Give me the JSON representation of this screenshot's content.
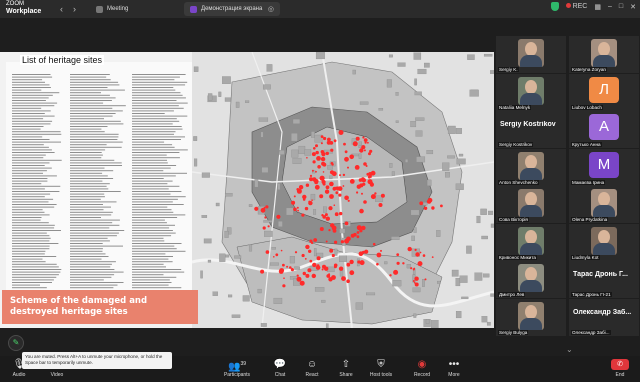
{
  "app": {
    "brand_top": "ZOOM",
    "brand_bottom": "Workplace"
  },
  "tabs": [
    {
      "label": "Meeting"
    },
    {
      "label": "Демонстрация экрана"
    }
  ],
  "topbar_right": {
    "rec_label": "REC"
  },
  "share": {
    "title": "List of heritage sites",
    "caption": "Scheme of the damaged and destroyed heritage sites"
  },
  "gallery": {
    "tiles": [
      {
        "name": "Sergiy K.",
        "type": "video"
      },
      {
        "name": "Kateryna Zoryan",
        "type": "video"
      },
      {
        "name": "Nataliia Melnyk",
        "type": "video"
      },
      {
        "name": "Liubov Lobach",
        "type": "letter",
        "letter": "Л",
        "color": "#f08a45"
      },
      {
        "name": "Sergiy Kostrikov",
        "type": "bigname",
        "big": "Sergiy Kostrikov"
      },
      {
        "name": "Крутько Анна",
        "type": "letter",
        "letter": "А",
        "color": "#9b68d8"
      },
      {
        "name": "Anton Shevchenko",
        "type": "video"
      },
      {
        "name": "Мамаєва Ірина",
        "type": "letter",
        "letter": "М",
        "color": "#7a45c8"
      },
      {
        "name": "Сова Вікторія",
        "type": "video"
      },
      {
        "name": "Olena Prydatkina",
        "type": "video"
      },
      {
        "name": "Кривонос Микита",
        "type": "video"
      },
      {
        "name": "Liudmyla Kot",
        "type": "video"
      },
      {
        "name": "Дмитро Лев",
        "type": "video"
      },
      {
        "name": "Тарас Дронь ГІ-21",
        "type": "bigname",
        "big": "Тарас Дронь Г..."
      },
      {
        "name": "Sergiy Bulyga",
        "type": "video"
      },
      {
        "name": "Олександр Забі...",
        "type": "bigname",
        "big": "Олександр Заб..."
      }
    ]
  },
  "tooltip": "You are muted. Press Alt+A to unmute your microphone, or hold the Space bar to temporarily unmute.",
  "toolbar": {
    "audio": "Audio",
    "video": "Video",
    "participants": "Participants",
    "participants_count": "39",
    "chat": "Chat",
    "react": "React",
    "share": "Share",
    "host_tools": "Host tools",
    "record": "Record",
    "more": "More",
    "end": "End"
  },
  "colors": {
    "accent": "#7a45c8",
    "end": "#e0363b",
    "caption_bg": "#e9826d",
    "map_marker": "#ff2a2a"
  }
}
